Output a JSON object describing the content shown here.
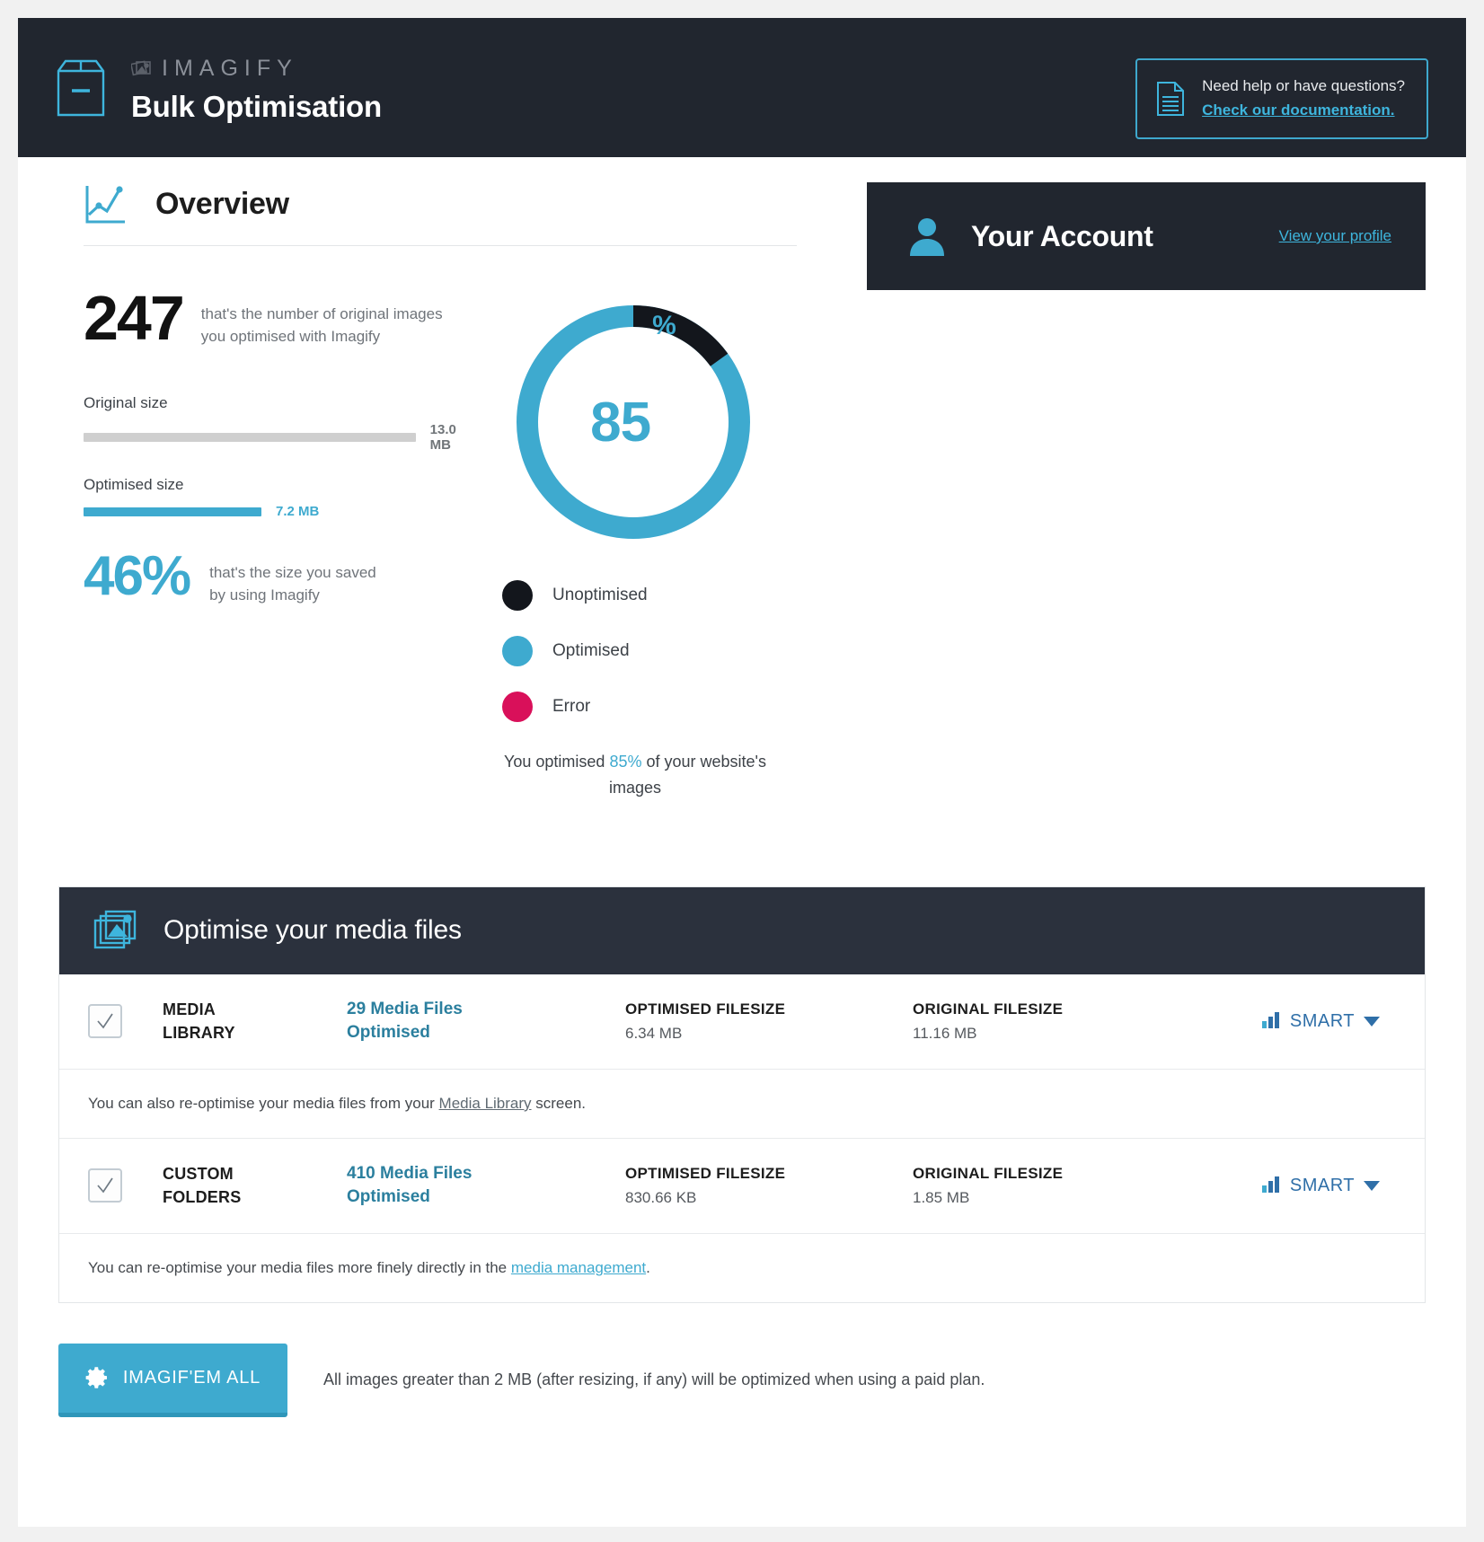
{
  "header": {
    "brand_name": "IMAGIFY",
    "title": "Bulk Optimisation",
    "help_question": "Need help or have questions?",
    "help_link": "Check our documentation.",
    "brand_icon": "box-icon",
    "help_icon": "document-icon"
  },
  "overview": {
    "title": "Overview",
    "icon": "chart-line-icon",
    "image_count": "247",
    "image_count_desc_line1": "that's the number of original images",
    "image_count_desc_line2": "you optimised with Imagify",
    "original_size_label": "Original size",
    "original_size_value": "13.0 MB",
    "optimised_size_label": "Optimised size",
    "optimised_size_value": "7.2 MB",
    "saved_percent": "46%",
    "saved_desc_line1": "that's the size you saved",
    "saved_desc_line2": "by using Imagify",
    "donut_value": "85",
    "donut_symbol": "%",
    "caption_pre": "You optimised ",
    "caption_highlight": "85%",
    "caption_post": " of your website's images",
    "legend": [
      {
        "label": "Unoptimised",
        "color": "#13161c"
      },
      {
        "label": "Optimised",
        "color": "#3eaacf"
      },
      {
        "label": "Error",
        "color": "#d9105a"
      }
    ]
  },
  "account": {
    "title": "Your Account",
    "link": "View your profile",
    "icon": "user-icon"
  },
  "media": {
    "panel_title": "Optimise your media files",
    "panel_icon": "images-icon",
    "rows": [
      {
        "name_line1": "MEDIA",
        "name_line2": "LIBRARY",
        "files_line1": "29 Media Files",
        "files_line2": "Optimised",
        "optimised_label": "OPTIMISED FILESIZE",
        "optimised_value": "6.34 MB",
        "original_label": "ORIGINAL FILESIZE",
        "original_value": "11.16 MB",
        "level": "SMART",
        "checked": true
      },
      {
        "name_line1": "CUSTOM",
        "name_line2": "FOLDERS",
        "files_line1": "410 Media Files",
        "files_line2": "Optimised",
        "optimised_label": "OPTIMISED FILESIZE",
        "optimised_value": "830.66 KB",
        "original_label": "ORIGINAL FILESIZE",
        "original_value": "1.85 MB",
        "level": "SMART",
        "checked": true
      }
    ],
    "note1_pre": "You can also re-optimise your media files from your ",
    "note1_link": "Media Library",
    "note1_post": " screen.",
    "note2_pre": "You can re-optimise your media files more finely directly in the ",
    "note2_link": "media management",
    "note2_post": "."
  },
  "footer": {
    "button_label": "IMAGIF'EM ALL",
    "button_icon": "gear-icon",
    "note": "All images greater than 2 MB (after resizing, if any) will be optimized when using a paid plan."
  },
  "chart_data": {
    "type": "pie",
    "title": "Optimisation status",
    "labels": [
      "Optimised",
      "Unoptimised",
      "Error"
    ],
    "values": [
      85,
      15,
      0
    ],
    "unit": "%",
    "colors": [
      "#3eaacf",
      "#13161c",
      "#d9105a"
    ],
    "center_label": "85%",
    "legend_position": "below",
    "donut": true,
    "secondary_bars": {
      "type": "bar",
      "categories": [
        "Original size",
        "Optimised size"
      ],
      "values": [
        13.0,
        7.2
      ],
      "unit": "MB",
      "value_labels": [
        "13.0 MB",
        "7.2 MB"
      ],
      "colors": [
        "#cfcfcf",
        "#3eaacf"
      ]
    }
  }
}
